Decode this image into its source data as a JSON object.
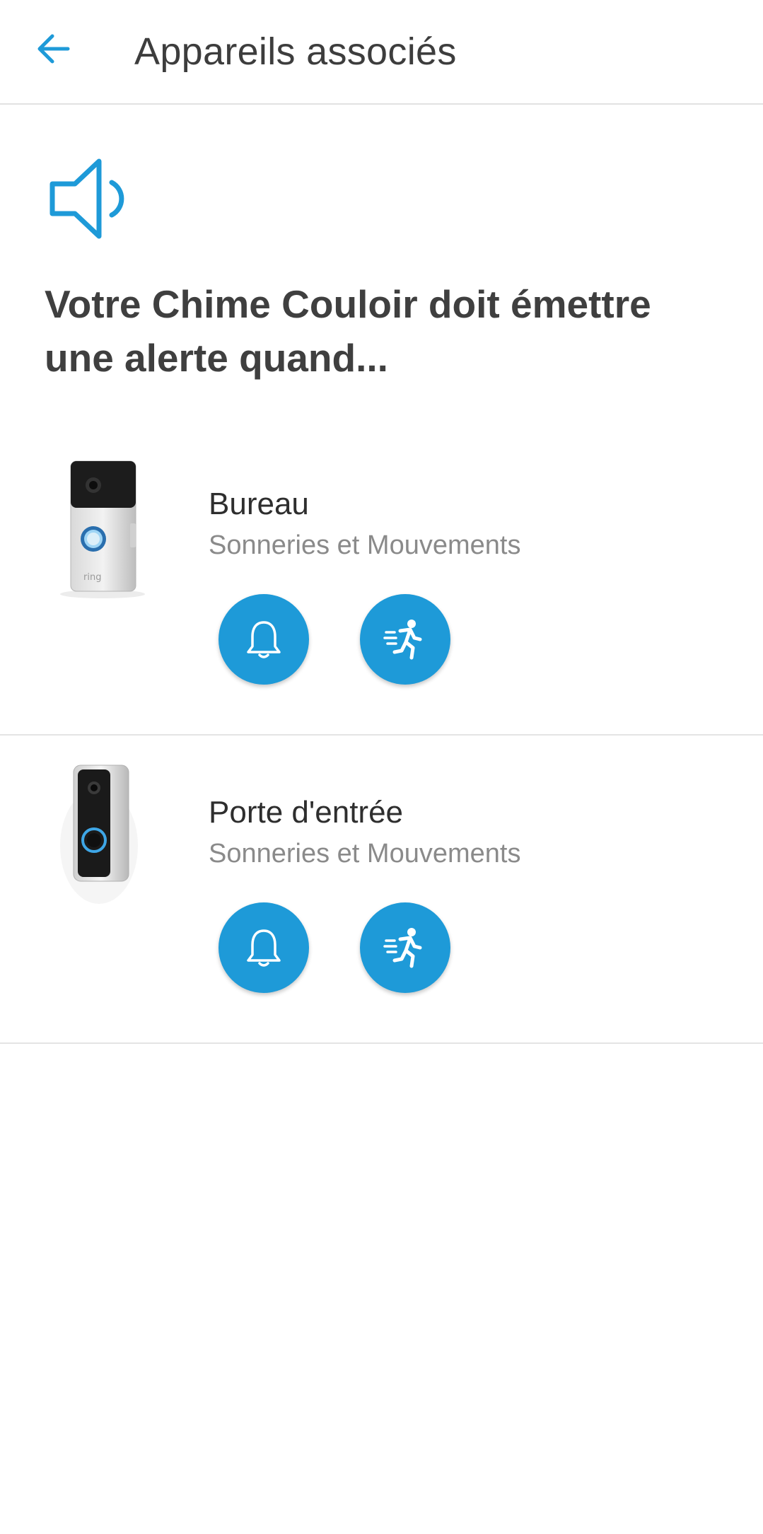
{
  "header": {
    "title": "Appareils associés",
    "back_icon": "arrow-left-icon"
  },
  "intro": {
    "icon": "speaker-icon",
    "headline": "Votre Chime Couloir doit émettre une alerte quand..."
  },
  "devices": [
    {
      "name": "Bureau",
      "subtitle": "Sonneries et Mouvements",
      "thumbnail": "video-doorbell-3-image",
      "buttons": {
        "rings": "bell-icon",
        "motion": "running-person-icon"
      }
    },
    {
      "name": "Porte d'entrée",
      "subtitle": "Sonneries et Mouvements",
      "thumbnail": "peephole-cam-image",
      "buttons": {
        "rings": "bell-icon",
        "motion": "running-person-icon"
      }
    }
  ],
  "colors": {
    "accent": "#1e9ad8",
    "title_text": "#3d3d3d",
    "subtitle_text": "#8a8a8a",
    "divider": "#e4e4e4"
  }
}
